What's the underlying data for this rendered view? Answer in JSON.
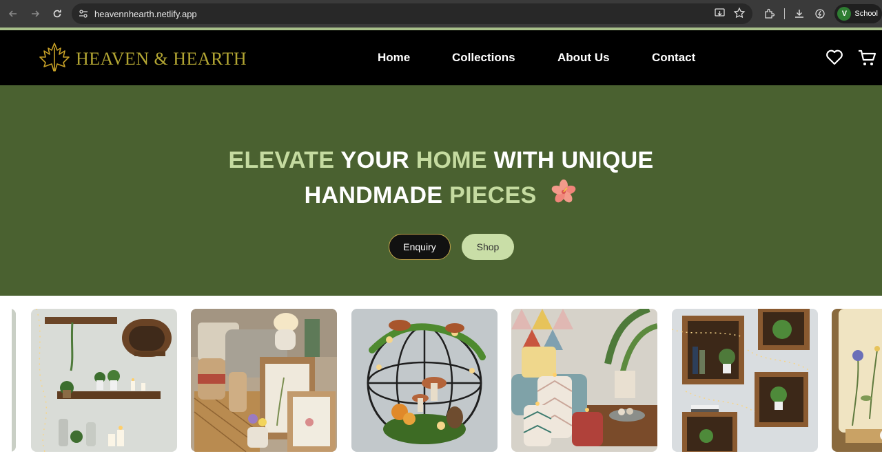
{
  "browser": {
    "url": "heavennhearth.netlify.app",
    "profile_initial": "V",
    "profile_name": "School"
  },
  "header": {
    "brand": "HEAVEN & HEARTH",
    "nav": [
      {
        "label": "Home"
      },
      {
        "label": "Collections"
      },
      {
        "label": "About Us"
      },
      {
        "label": "Contact"
      }
    ]
  },
  "hero": {
    "title_parts": {
      "w1": "ELEVATE",
      "w2": "YOUR",
      "w3": "HOME",
      "w4": "WITH UNIQUE",
      "w5": "HANDMADE",
      "w6": "PIECES"
    },
    "enquiry_label": "Enquiry",
    "shop_label": "Shop"
  },
  "gallery": {
    "items": [
      {
        "name": "floating-wood-shelves-with-candles"
      },
      {
        "name": "frames-and-woven-baskets"
      },
      {
        "name": "sphere-planter-with-mushrooms"
      },
      {
        "name": "geometric-candle-holders"
      },
      {
        "name": "wooden-crate-shelves"
      },
      {
        "name": "pressed-flower-lamp"
      }
    ]
  },
  "colors": {
    "header_bg": "#000000",
    "brand_gold": "#b3a633",
    "hero_bg": "#4a6130",
    "hero_highlight": "#c5dba0",
    "shop_button": "#c9dea7"
  }
}
